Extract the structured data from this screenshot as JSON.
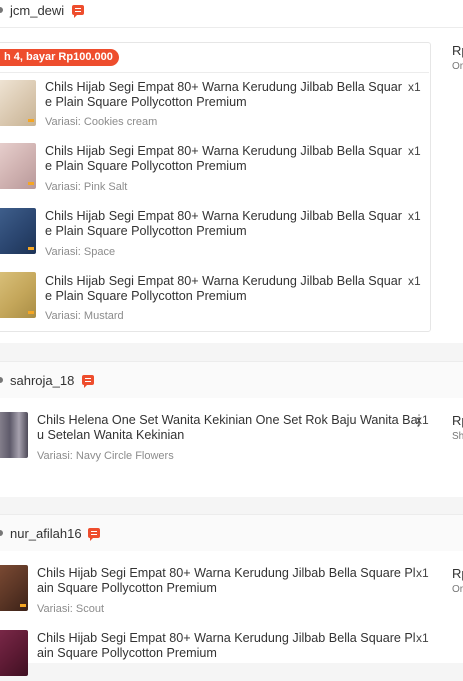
{
  "shops": [
    {
      "name": "jcm_dewi",
      "promo_badge": "h 4, bayar Rp100.000",
      "price_prefix": "Rp",
      "price_sub": "Or",
      "items": [
        {
          "title_1": "Chils Hijab Segi Empat 80+ Warna Kerudung Jilbab Bella Squar",
          "title_2": "e Plain Square Pollycotton Premium",
          "variant": "Variasi: Cookies cream",
          "qty": "x1",
          "color": "#e6d8c4",
          "thumb_icon": "hijab-cookies-cream-thumbnail"
        },
        {
          "title_1": "Chils Hijab Segi Empat 80+ Warna Kerudung Jilbab Bella Squar",
          "title_2": "e Plain Square Pollycotton Premium",
          "variant": "Variasi: Pink Salt",
          "qty": "x1",
          "color": "#d6b9b8",
          "thumb_icon": "hijab-pink-salt-thumbnail"
        },
        {
          "title_1": "Chils Hijab Segi Empat 80+ Warna Kerudung Jilbab Bella Squar",
          "title_2": "e Plain Square Pollycotton Premium",
          "variant": "Variasi: Space",
          "qty": "x1",
          "color": "#2e4d78",
          "thumb_icon": "hijab-space-thumbnail"
        },
        {
          "title_1": "Chils Hijab Segi Empat 80+ Warna Kerudung Jilbab Bella Squar",
          "title_2": "e Plain Square Pollycotton Premium",
          "variant": "Variasi: Mustard",
          "qty": "x1",
          "color": "#c9ad62",
          "thumb_icon": "hijab-mustard-thumbnail"
        }
      ]
    },
    {
      "name": "sahroja_18",
      "price_prefix": "Rp",
      "price_sub": "Sh",
      "items": [
        {
          "title_1": "Chils Helena One Set Wanita Kekinian One Set Rok Baju Wanita Baj",
          "title_2": "u Setelan Wanita Kekinian",
          "variant": "Variasi: Navy Circle Flowers",
          "qty": "x1",
          "color": "#6e6a78",
          "thumb_icon": "one-set-navy-flowers-thumbnail"
        }
      ]
    },
    {
      "name": "nur_afilah16",
      "price_prefix": "Rp",
      "price_sub": "Or",
      "items": [
        {
          "title_1": "Chils Hijab Segi Empat 80+ Warna Kerudung Jilbab Bella Square Pl",
          "title_2": "ain Square Pollycotton Premium",
          "variant": "Variasi: Scout",
          "qty": "x1",
          "color": "#5a3525",
          "thumb_icon": "hijab-scout-thumbnail"
        },
        {
          "title_1": "Chils Hijab Segi Empat 80+ Warna Kerudung Jilbab Bella Square Pl",
          "title_2": "ain Square Pollycotton Premium",
          "variant": "",
          "qty": "x1",
          "color": "#5c1a33",
          "thumb_icon": "hijab-maroon-thumbnail"
        }
      ]
    }
  ]
}
